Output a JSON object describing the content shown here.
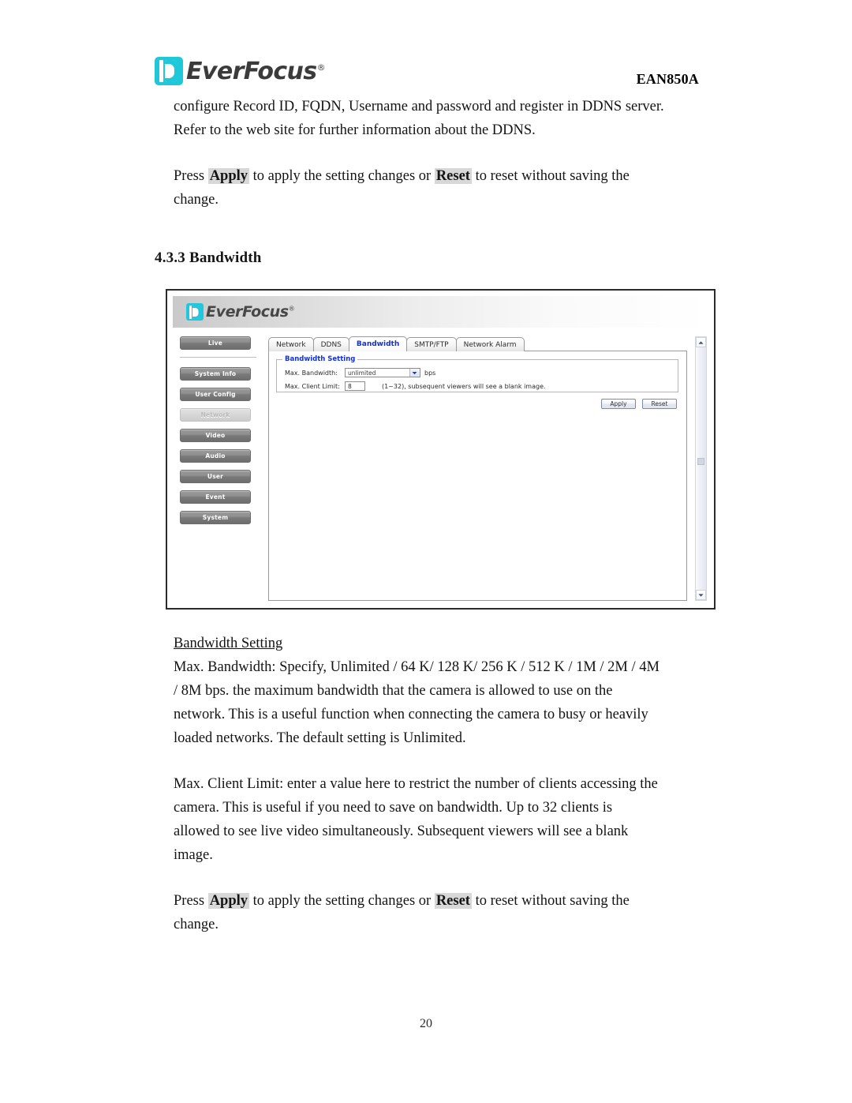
{
  "document": {
    "brand": "EverFocus",
    "brand_registered": "®",
    "model_code": "EAN850A",
    "page_number": "20"
  },
  "paragraphs": {
    "intro_line1": "configure Record ID, FQDN, Username and password and register in DDNS server.",
    "intro_line2": "Refer to the web site for further information about the DDNS.",
    "press_prefix": "Press ",
    "press_apply": "Apply",
    "press_mid": " to apply the setting changes or ",
    "press_reset": "Reset",
    "press_suffix": " to reset without saving the",
    "press_line2": "change.",
    "section_heading": "4.3.3 Bandwidth",
    "subhead": "Bandwidth Setting",
    "max_bandwidth_desc_l1": "Max. Bandwidth: Specify, Unlimited / 64 K/ 128 K/ 256 K / 512 K / 1M / 2M / 4M",
    "max_bandwidth_desc_l2": "/ 8M bps. the maximum bandwidth that the camera is allowed to use on the",
    "max_bandwidth_desc_l3": "network. This is a useful function when connecting the camera to busy or heavily",
    "max_bandwidth_desc_l4": "loaded networks. The default setting is Unlimited.",
    "max_client_desc_l1": "Max. Client Limit: enter a value here to restrict the number of clients accessing the",
    "max_client_desc_l2": "camera. This is useful if you need to save on bandwidth. Up to 32 clients is",
    "max_client_desc_l3": "allowed to see live video simultaneously. Subsequent viewers will see a blank",
    "max_client_desc_l4": "image."
  },
  "screenshot": {
    "banner_brand": "EverFocus",
    "banner_registered": "®",
    "sidebar": {
      "live": "Live",
      "items": [
        {
          "label": "System Info",
          "active": false
        },
        {
          "label": "User Config",
          "active": false
        },
        {
          "label": "Network",
          "active": true
        },
        {
          "label": "Video",
          "active": false
        },
        {
          "label": "Audio",
          "active": false
        },
        {
          "label": "User",
          "active": false
        },
        {
          "label": "Event",
          "active": false
        },
        {
          "label": "System",
          "active": false
        }
      ]
    },
    "tabs": [
      {
        "label": "Network",
        "selected": false
      },
      {
        "label": "DDNS",
        "selected": false
      },
      {
        "label": "Bandwidth",
        "selected": true
      },
      {
        "label": "SMTP/FTP",
        "selected": false
      },
      {
        "label": "Network Alarm",
        "selected": false
      }
    ],
    "fieldset_legend": "Bandwidth Setting",
    "form": {
      "max_bandwidth_label": "Max. Bandwidth:",
      "max_bandwidth_value": "unlimited",
      "max_bandwidth_unit": "bps",
      "max_client_label": "Max. Client Limit:",
      "max_client_value": "8",
      "max_client_hint": "(1~32), subsequent viewers will see a blank image."
    },
    "buttons": {
      "apply": "Apply",
      "reset": "Reset"
    }
  },
  "colors": {
    "logo_teal": "#1ec8d8",
    "tab_selected_text": "#1330d8",
    "legend_text": "#1330d8",
    "highlight_bg": "#d8d8d8"
  }
}
